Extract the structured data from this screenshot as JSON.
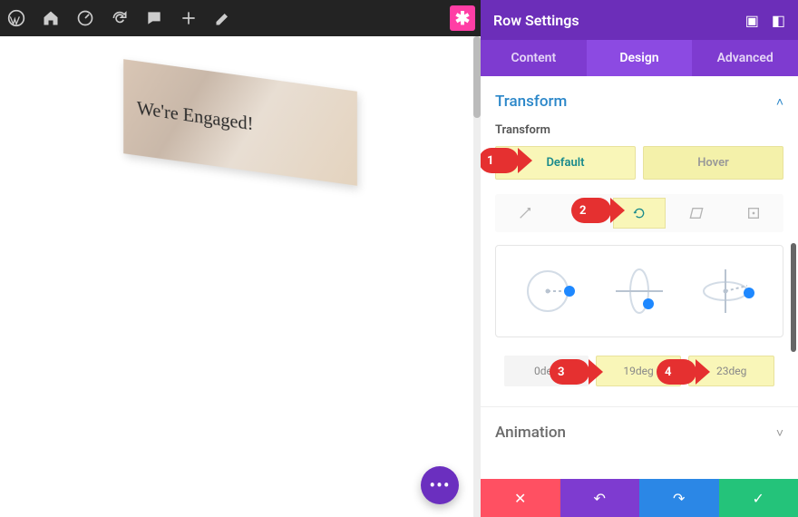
{
  "preview": {
    "banner_text": "We're Engaged!"
  },
  "admin_bar": {
    "brand_sym": "✱"
  },
  "panel": {
    "title": "Row Settings",
    "tabs": [
      "Content",
      "Design",
      "Advanced"
    ],
    "active_tab": 1
  },
  "transform": {
    "section_title": "Transform",
    "sub_label": "Transform",
    "state_tabs": [
      "Default",
      "Hover"
    ],
    "active_state": 0,
    "values": [
      "0deg",
      "19deg",
      "23deg"
    ]
  },
  "animation": {
    "section_title": "Animation"
  },
  "callouts": [
    "1",
    "2",
    "3",
    "4"
  ]
}
